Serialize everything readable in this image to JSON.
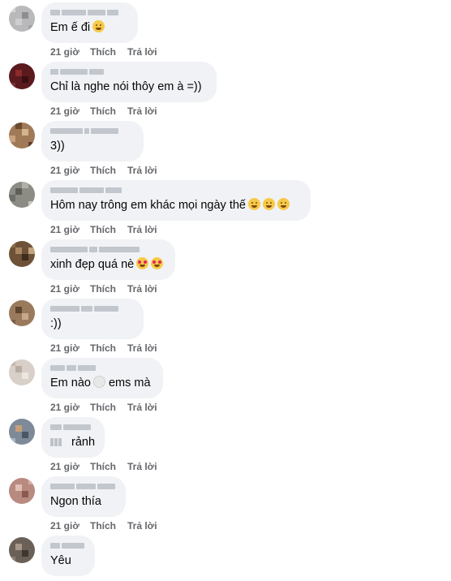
{
  "comments": [
    {
      "text": "Em ế đi",
      "emoji": [
        "smile"
      ],
      "time": "21 giờ",
      "like": "Thích",
      "reply": "Trả lời"
    },
    {
      "text": "Chỉ là nghe nói thôy em à =))",
      "emoji": [],
      "time": "21 giờ",
      "like": "Thích",
      "reply": "Trả lời"
    },
    {
      "text": "3))",
      "emoji": [],
      "time": "21 giờ",
      "like": "Thích",
      "reply": "Trả lời"
    },
    {
      "text": "Hôm nay trông em khác mọi ngày thế",
      "emoji": [
        "rofl",
        "rofl",
        "rofl"
      ],
      "time": "21 giờ",
      "like": "Thích",
      "reply": "Trả lời"
    },
    {
      "text": "xinh đẹp quá nè",
      "emoji": [
        "heart-eyes",
        "heart-eyes"
      ],
      "time": "21 giờ",
      "like": "Thích",
      "reply": "Trả lời"
    },
    {
      "text": ":))",
      "emoji": [],
      "time": "21 giờ",
      "like": "Thích",
      "reply": "Trả lời"
    },
    {
      "text": "Em nào",
      "emoji": [
        "moon"
      ],
      "text2": "ems mà",
      "time": "21 giờ",
      "like": "Thích",
      "reply": "Trả lời"
    },
    {
      "text": "rảnh",
      "emoji": [],
      "time": "21 giờ",
      "like": "Thích",
      "reply": "Trả lời"
    },
    {
      "text": "Ngon thía",
      "emoji": [],
      "time": "21 giờ",
      "like": "Thích",
      "reply": "Trả lời"
    },
    {
      "text": "Yêu",
      "emoji": [],
      "time": "",
      "like": "",
      "reply": ""
    }
  ],
  "colors": {
    "bubble": "#f0f2f5",
    "meta": "#65676b",
    "text": "#050505"
  }
}
